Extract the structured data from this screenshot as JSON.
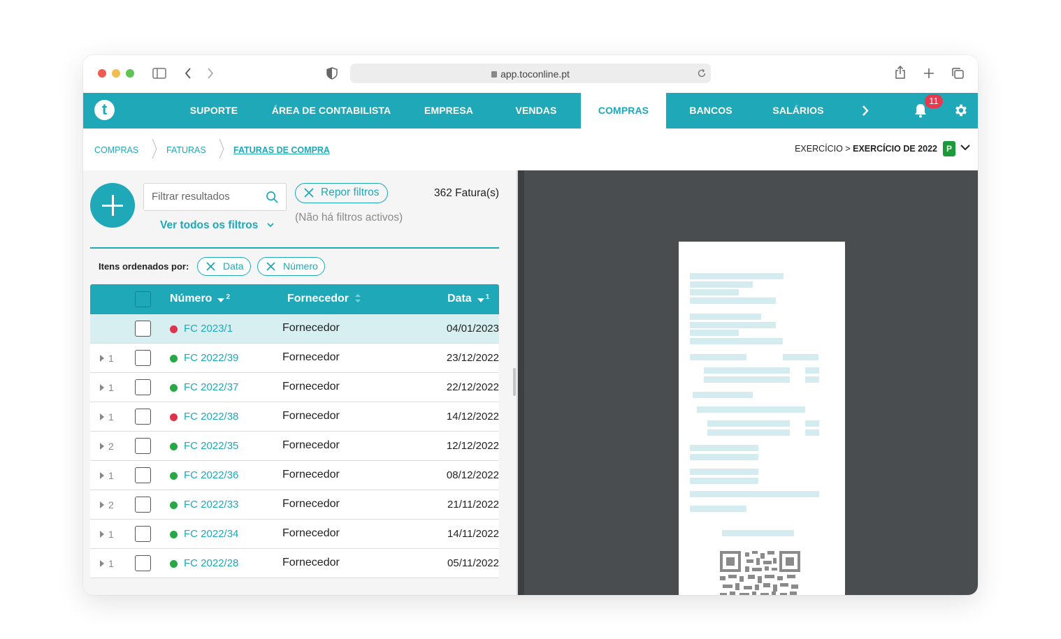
{
  "browser": {
    "url": "app.toconline.pt"
  },
  "nav": {
    "logo_letter": "t",
    "items": [
      "SUPORTE",
      "ÁREA DE CONTABILISTA",
      "EMPRESA",
      "VENDAS",
      "COMPRAS",
      "BANCOS",
      "SALÁRIOS"
    ],
    "active": "COMPRAS",
    "notifications_count": "11"
  },
  "breadcrumb": {
    "items": [
      "COMPRAS",
      "FATURAS",
      "FATURAS DE COMPRA"
    ],
    "exercise_label": "EXERCÍCIO > ",
    "exercise_value": "EXERCÍCIO DE 2022",
    "exercise_badge": "P"
  },
  "filters": {
    "search_placeholder": "Filtrar resultados",
    "reset_label": "Repor filtros",
    "no_filters_text": "(Não há filtros activos)",
    "count_text": "362 Fatura(s)",
    "see_all_label": "Ver todos os filtros"
  },
  "sorting": {
    "label": "Itens ordenados por:",
    "chips": [
      "Data",
      "Número"
    ]
  },
  "table": {
    "columns": {
      "number": "Número",
      "number_sort_index": "2",
      "supplier": "Fornecedor",
      "date": "Data",
      "date_sort_index": "1"
    },
    "rows": [
      {
        "expand": "",
        "status": "red",
        "number": "FC 2023/1",
        "supplier": "Fornecedor",
        "date": "04/01/2023",
        "selected": true
      },
      {
        "expand": "1",
        "status": "green",
        "number": "FC 2022/39",
        "supplier": "Fornecedor",
        "date": "23/12/2022"
      },
      {
        "expand": "1",
        "status": "green",
        "number": "FC 2022/37",
        "supplier": "Fornecedor",
        "date": "22/12/2022"
      },
      {
        "expand": "1",
        "status": "red",
        "number": "FC 2022/38",
        "supplier": "Fornecedor",
        "date": "14/12/2022"
      },
      {
        "expand": "2",
        "status": "green",
        "number": "FC 2022/35",
        "supplier": "Fornecedor",
        "date": "12/12/2022"
      },
      {
        "expand": "1",
        "status": "green",
        "number": "FC 2022/36",
        "supplier": "Fornecedor",
        "date": "08/12/2022"
      },
      {
        "expand": "2",
        "status": "green",
        "number": "FC 2022/33",
        "supplier": "Fornecedor",
        "date": "21/11/2022"
      },
      {
        "expand": "1",
        "status": "green",
        "number": "FC 2022/34",
        "supplier": "Fornecedor",
        "date": "14/11/2022"
      },
      {
        "expand": "1",
        "status": "green",
        "number": "FC 2022/28",
        "supplier": "Fornecedor",
        "date": "05/11/2022"
      }
    ]
  },
  "colors": {
    "accent": "#1fa8b8",
    "status_red": "#e0334d",
    "status_green": "#27a745",
    "preview_bg": "#4a4d4f"
  }
}
